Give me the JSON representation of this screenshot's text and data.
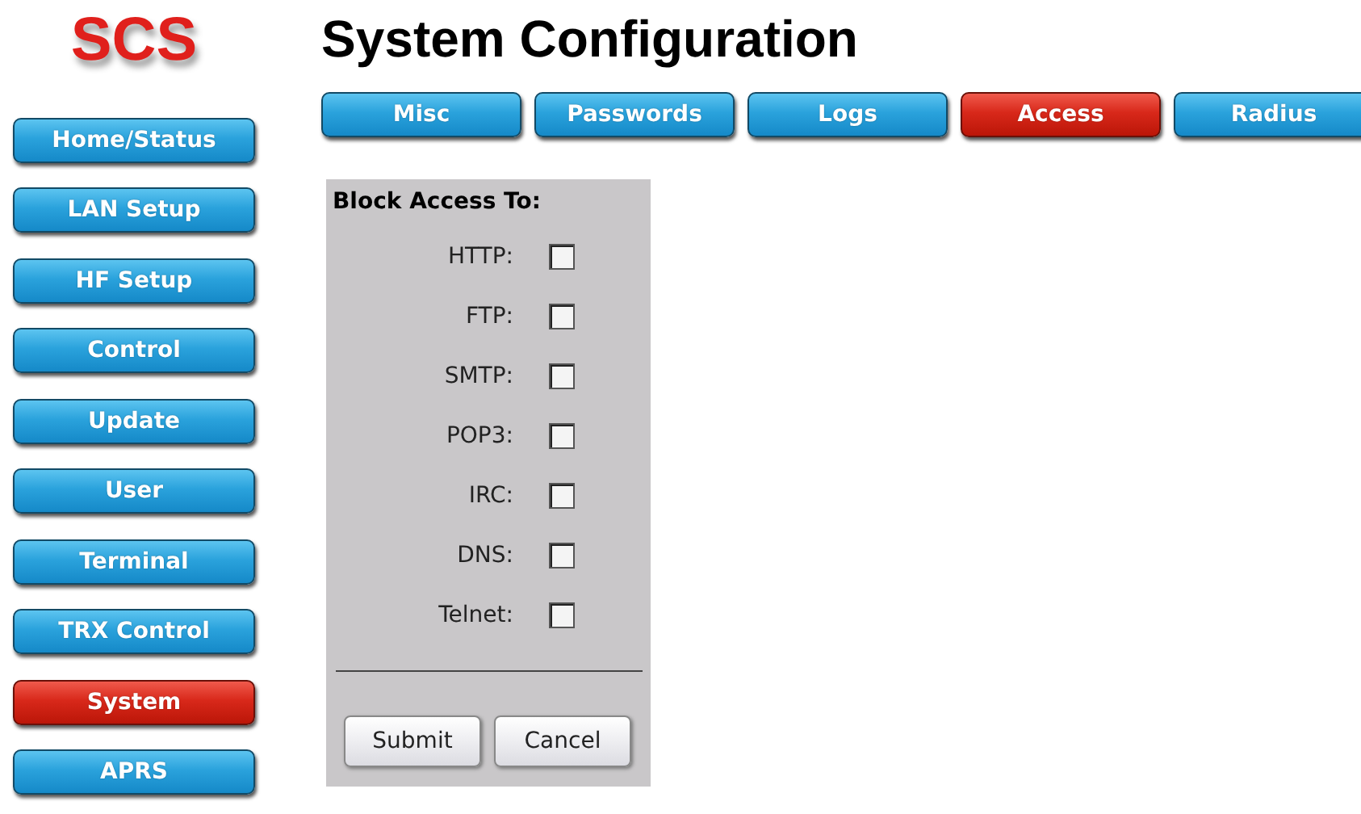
{
  "logo": "SCS",
  "title": "System Configuration",
  "sidebar": {
    "items": [
      {
        "label": "Home/Status",
        "selected": false
      },
      {
        "label": "LAN Setup",
        "selected": false
      },
      {
        "label": "HF Setup",
        "selected": false
      },
      {
        "label": "Control",
        "selected": false
      },
      {
        "label": "Update",
        "selected": false
      },
      {
        "label": "User",
        "selected": false
      },
      {
        "label": "Terminal",
        "selected": false
      },
      {
        "label": "TRX Control",
        "selected": false
      },
      {
        "label": "System",
        "selected": true
      },
      {
        "label": "APRS",
        "selected": false
      }
    ]
  },
  "tabs": [
    {
      "label": "Misc",
      "selected": false
    },
    {
      "label": "Passwords",
      "selected": false
    },
    {
      "label": "Logs",
      "selected": false
    },
    {
      "label": "Access",
      "selected": true
    },
    {
      "label": "Radius",
      "selected": false
    }
  ],
  "form": {
    "heading": "Block Access To:",
    "options": [
      {
        "label": "HTTP:",
        "checked": false
      },
      {
        "label": "FTP:",
        "checked": false
      },
      {
        "label": "SMTP:",
        "checked": false
      },
      {
        "label": "POP3:",
        "checked": false
      },
      {
        "label": "IRC:",
        "checked": false
      },
      {
        "label": "DNS:",
        "checked": false
      },
      {
        "label": "Telnet:",
        "checked": false
      }
    ],
    "buttons": [
      "Submit",
      "Cancel"
    ]
  }
}
